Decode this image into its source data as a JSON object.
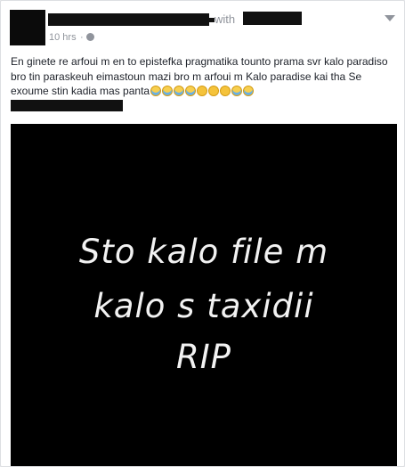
{
  "post": {
    "with_label": "with",
    "timestamp": "10 hrs",
    "separator": "·",
    "privacy_icon": "globe-icon",
    "menu_icon": "chevron-down-icon",
    "text": "En ginete re arfoui m en to epistefka pragmatika tounto prama svr kalo paradiso bro tin paraskeuh eimastoun mazi bro m arfoui m Kalo paradise kai tha Se exoume stin kadia mas panta",
    "emojis": [
      "crying-face",
      "crying-face",
      "crying-face",
      "crying-face",
      "sad-face",
      "sad-face",
      "sad-face",
      "crying-face",
      "crying-face"
    ]
  },
  "photo": {
    "lines": [
      "Sto kalo file m",
      "kalo s taxidii",
      "RIP"
    ]
  },
  "colors": {
    "card_bg": "#ffffff",
    "page_bg": "#e9ebee",
    "meta_text": "#90949c",
    "body_text": "#1d2129",
    "photo_bg": "#000000"
  }
}
